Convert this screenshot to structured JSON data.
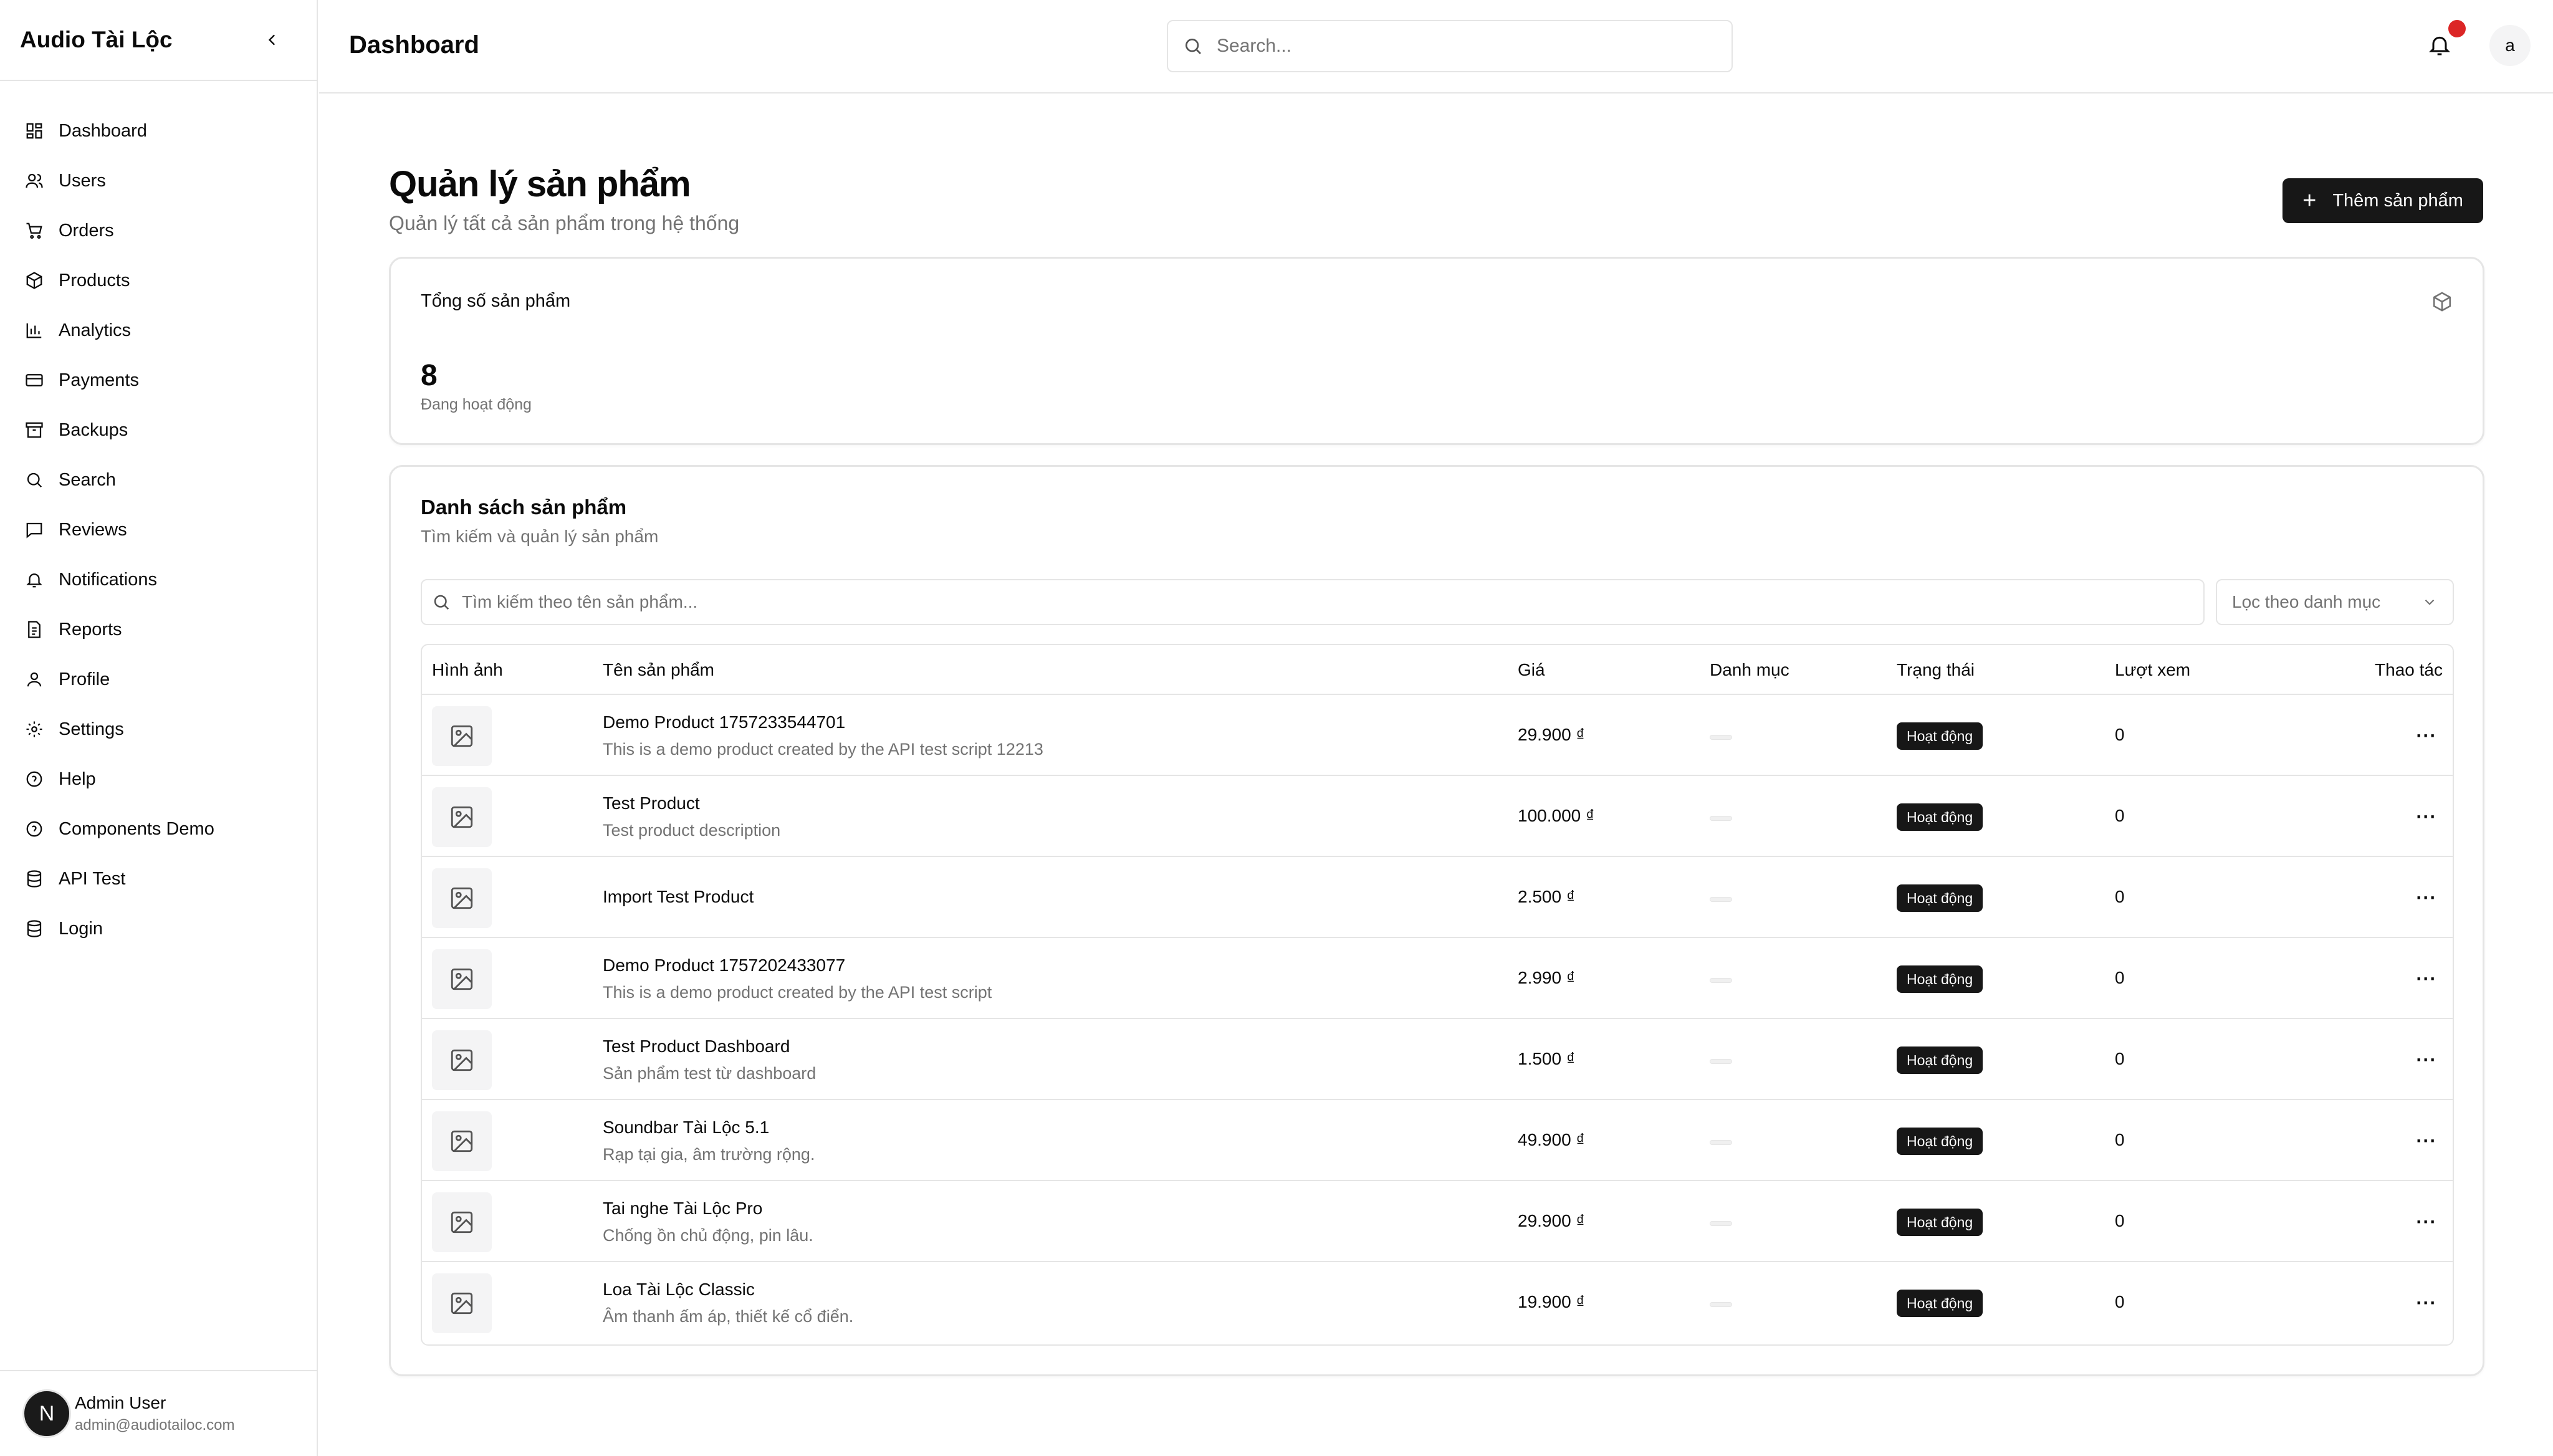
{
  "sidebar": {
    "app_title": "Audio Tài Lộc",
    "items": [
      {
        "label": "Dashboard",
        "icon": "dashboard-icon"
      },
      {
        "label": "Users",
        "icon": "users-icon"
      },
      {
        "label": "Orders",
        "icon": "cart-icon"
      },
      {
        "label": "Products",
        "icon": "package-icon"
      },
      {
        "label": "Analytics",
        "icon": "chart-icon"
      },
      {
        "label": "Payments",
        "icon": "credit-card-icon"
      },
      {
        "label": "Backups",
        "icon": "archive-icon"
      },
      {
        "label": "Search",
        "icon": "search-icon"
      },
      {
        "label": "Reviews",
        "icon": "message-icon"
      },
      {
        "label": "Notifications",
        "icon": "bell-icon"
      },
      {
        "label": "Reports",
        "icon": "report-icon"
      },
      {
        "label": "Profile",
        "icon": "user-icon"
      },
      {
        "label": "Settings",
        "icon": "gear-icon"
      },
      {
        "label": "Help",
        "icon": "help-icon"
      },
      {
        "label": "Components Demo",
        "icon": "help-icon"
      },
      {
        "label": "API Test",
        "icon": "database-icon"
      },
      {
        "label": "Login",
        "icon": "database-icon"
      }
    ],
    "user": {
      "initial": "N",
      "name": "Admin User",
      "email": "admin@audiotailoc.com"
    }
  },
  "header": {
    "title": "Dashboard",
    "search_placeholder": "Search...",
    "avatar_initial": "a"
  },
  "main": {
    "title": "Quản lý sản phẩm",
    "subtitle": "Quản lý tất cả sản phẩm trong hệ thống",
    "add_button": "Thêm sản phẩm",
    "stats": {
      "label": "Tổng số sản phẩm",
      "value": "8",
      "note": "Đang hoạt động"
    },
    "list": {
      "title": "Danh sách sản phẩm",
      "subtitle": "Tìm kiếm và quản lý sản phẩm",
      "search_placeholder": "Tìm kiếm theo tên sản phẩm...",
      "filter_label": "Lọc theo danh mục",
      "columns": [
        "Hình ảnh",
        "Tên sản phẩm",
        "Giá",
        "Danh mục",
        "Trạng thái",
        "Lượt xem",
        "Thao tác"
      ],
      "rows": [
        {
          "name": "Demo Product 1757233544701",
          "desc": "This is a demo product created by the API test script 12213",
          "price": "29.900 ₫",
          "status": "Hoạt động",
          "views": "0"
        },
        {
          "name": "Test Product",
          "desc": "Test product description",
          "price": "100.000 ₫",
          "status": "Hoạt động",
          "views": "0"
        },
        {
          "name": "Import Test Product",
          "desc": "",
          "price": "2.500 ₫",
          "status": "Hoạt động",
          "views": "0"
        },
        {
          "name": "Demo Product 1757202433077",
          "desc": "This is a demo product created by the API test script",
          "price": "2.990 ₫",
          "status": "Hoạt động",
          "views": "0"
        },
        {
          "name": "Test Product Dashboard",
          "desc": "Sản phẩm test từ dashboard",
          "price": "1.500 ₫",
          "status": "Hoạt động",
          "views": "0"
        },
        {
          "name": "Soundbar Tài Lộc 5.1",
          "desc": "Rạp tại gia, âm trường rộng.",
          "price": "49.900 ₫",
          "status": "Hoạt động",
          "views": "0"
        },
        {
          "name": "Tai nghe Tài Lộc Pro",
          "desc": "Chống ồn chủ động, pin lâu.",
          "price": "29.900 ₫",
          "status": "Hoạt động",
          "views": "0"
        },
        {
          "name": "Loa Tài Lộc Classic",
          "desc": "Âm thanh ấm áp, thiết kế cổ điển.",
          "price": "19.900 ₫",
          "status": "Hoạt động",
          "views": "0"
        }
      ]
    }
  },
  "colors": {
    "accent": "#171717",
    "border": "#e5e5e5",
    "muted": "#737373",
    "notification_dot": "#dc2626"
  }
}
